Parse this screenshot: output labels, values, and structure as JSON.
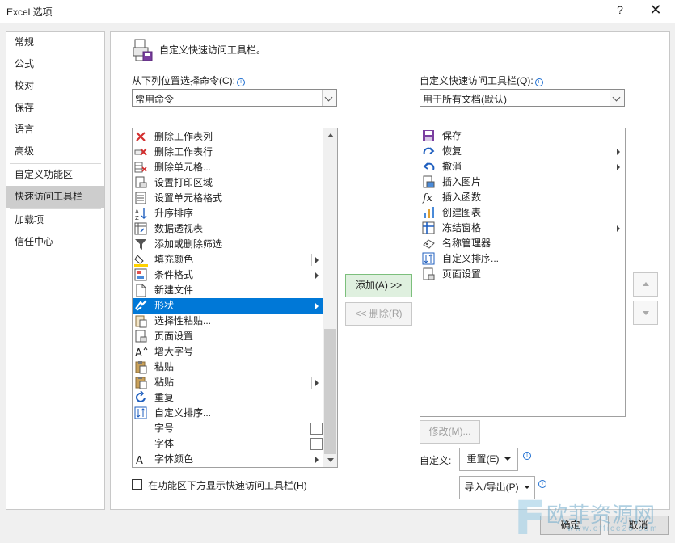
{
  "window": {
    "title": "Excel 选项",
    "help": "?",
    "close": "✕"
  },
  "nav": {
    "items": [
      {
        "label": "常规"
      },
      {
        "label": "公式"
      },
      {
        "label": "校对"
      },
      {
        "label": "保存"
      },
      {
        "label": "语言"
      },
      {
        "label": "高级"
      },
      {
        "label": "自定义功能区"
      },
      {
        "label": "快速访问工具栏",
        "selected": true
      },
      {
        "label": "加载项"
      },
      {
        "label": "信任中心"
      }
    ]
  },
  "header": {
    "text": "自定义快速访问工具栏。",
    "icon": "quick-access-toolbar-icon"
  },
  "left": {
    "label": "从下列位置选择命令(C):",
    "dropdown_value": "常用命令",
    "items": [
      {
        "label": "删除工作表列",
        "icon": "delete-column-icon"
      },
      {
        "label": "删除工作表行",
        "icon": "delete-row-icon"
      },
      {
        "label": "删除单元格...",
        "icon": "delete-cells-icon"
      },
      {
        "label": "设置打印区域",
        "icon": "print-area-icon"
      },
      {
        "label": "设置单元格格式",
        "icon": "format-cells-icon"
      },
      {
        "label": "升序排序",
        "icon": "sort-ascending-icon"
      },
      {
        "label": "数据透视表",
        "icon": "pivot-table-icon"
      },
      {
        "label": "添加或删除筛选",
        "icon": "filter-icon"
      },
      {
        "label": "填充颜色",
        "icon": "fill-color-icon"
      },
      {
        "label": "条件格式",
        "icon": "conditional-format-icon"
      },
      {
        "label": "新建文件",
        "icon": "new-file-icon"
      },
      {
        "label": "形状",
        "icon": "shapes-icon"
      },
      {
        "label": "选择性粘贴...",
        "icon": "paste-special-icon"
      },
      {
        "label": "页面设置",
        "icon": "page-setup-icon"
      },
      {
        "label": "增大字号",
        "icon": "increase-font-icon"
      },
      {
        "label": "粘贴",
        "icon": "paste-icon"
      },
      {
        "label": "粘贴",
        "icon": "paste-icon"
      },
      {
        "label": "重复",
        "icon": "repeat-icon"
      },
      {
        "label": "自定义排序...",
        "icon": "custom-sort-icon"
      },
      {
        "label": "字号",
        "icon": ""
      },
      {
        "label": "字体",
        "icon": ""
      },
      {
        "label": "字体颜色",
        "icon": "font-color-icon"
      }
    ],
    "selected_item": "形状"
  },
  "right": {
    "label": "自定义快速访问工具栏(Q):",
    "dropdown_value": "用于所有文档(默认)",
    "items": [
      {
        "label": "保存",
        "icon": "save-icon"
      },
      {
        "label": "恢复",
        "icon": "redo-icon"
      },
      {
        "label": "撤消",
        "icon": "undo-icon"
      },
      {
        "label": "插入图片",
        "icon": "insert-picture-icon"
      },
      {
        "label": "插入函数",
        "icon": "function-icon"
      },
      {
        "label": "创建图表",
        "icon": "chart-icon"
      },
      {
        "label": "冻结窗格",
        "icon": "freeze-panes-icon"
      },
      {
        "label": "名称管理器",
        "icon": "name-manager-icon"
      },
      {
        "label": "自定义排序...",
        "icon": "custom-sort-icon"
      },
      {
        "label": "页面设置",
        "icon": "page-setup-icon"
      }
    ]
  },
  "buttons": {
    "add": "添加(A) >>",
    "remove": "<< 删除(R)",
    "modify": "修改(M)...",
    "customize_label": "自定义:",
    "reset": "重置(E)",
    "import_export": "导入/导出(P)",
    "ok": "确定",
    "cancel": "取消"
  },
  "checkbox": {
    "label": "在功能区下方显示快速访问工具栏(H)",
    "checked": false
  },
  "watermark": {
    "big": "欧菲资源网",
    "small": "www.office26.com"
  }
}
